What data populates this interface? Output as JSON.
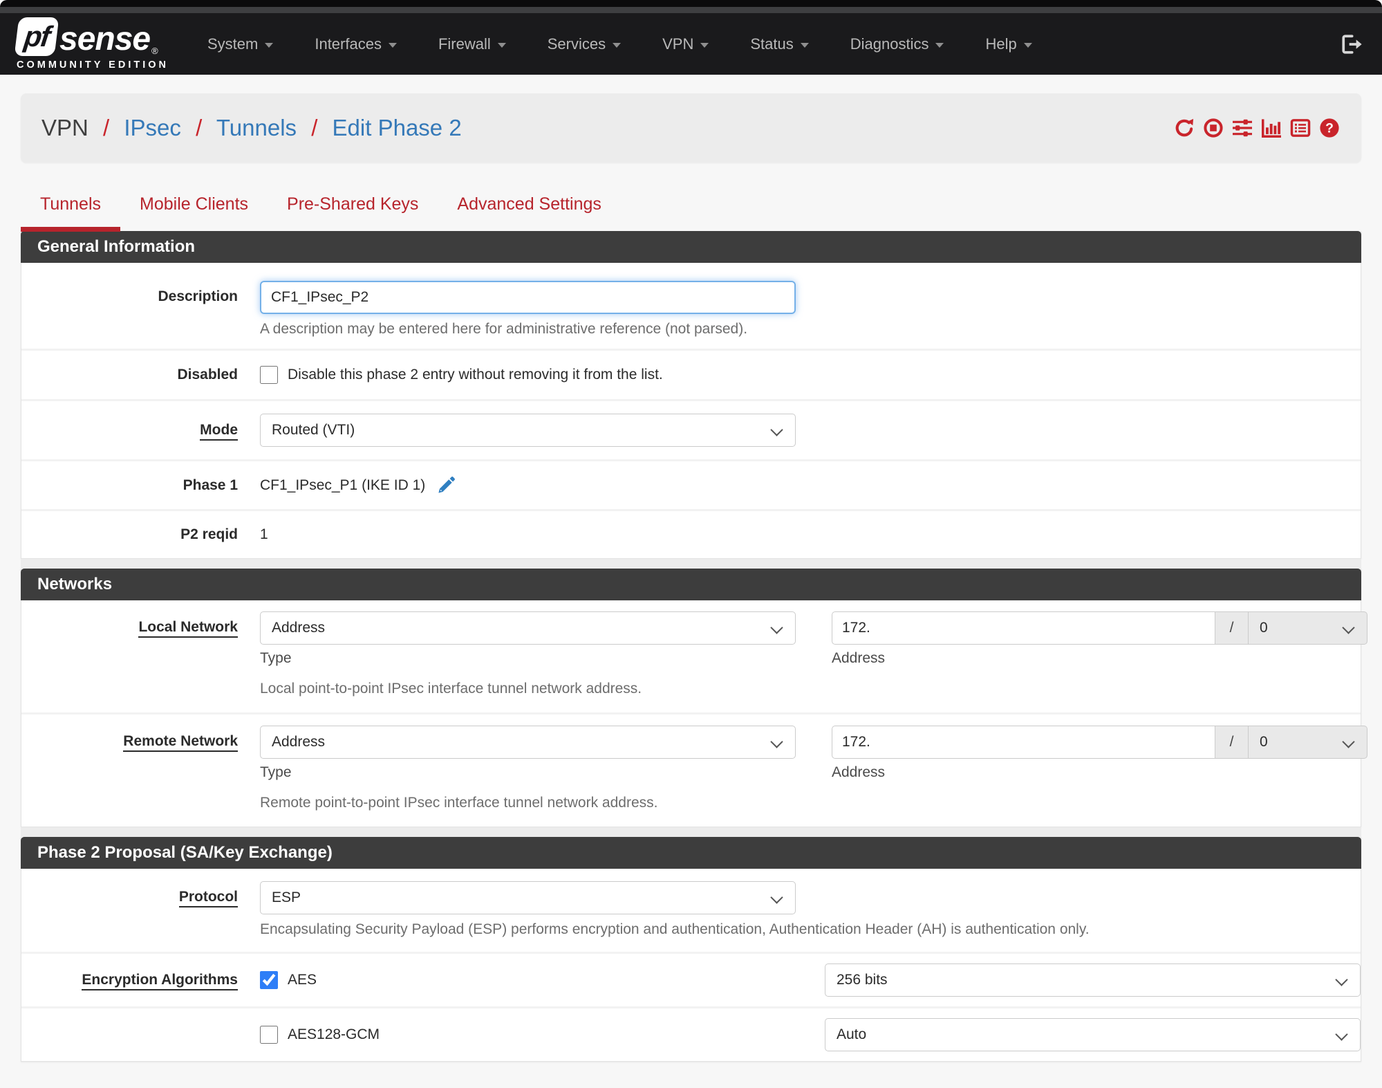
{
  "colors": {
    "accent_red": "#c9242b",
    "link_blue": "#3579b8",
    "checkbox_blue": "#2e7ef7",
    "header_gray": "#3d3d3d"
  },
  "navbar": {
    "brand": {
      "pf": "pf",
      "sense": "sense",
      "mark": "®",
      "edition": "COMMUNITY EDITION"
    },
    "menu": [
      "System",
      "Interfaces",
      "Firewall",
      "Services",
      "VPN",
      "Status",
      "Diagnostics",
      "Help"
    ],
    "logout_icon": "logout-icon"
  },
  "breadcrumb": {
    "root": "VPN",
    "sep": "/",
    "links": [
      "IPsec",
      "Tunnels",
      "Edit Phase 2"
    ],
    "action_icons": [
      "refresh-icon",
      "stop-circle-icon",
      "sliders-icon",
      "chart-bar-icon",
      "log-icon",
      "help-icon"
    ]
  },
  "tabs": [
    "Tunnels",
    "Mobile Clients",
    "Pre-Shared Keys",
    "Advanced Settings"
  ],
  "general": {
    "title": "General Information",
    "description": {
      "label": "Description",
      "value": "CF1_IPsec_P2",
      "help": "A description may be entered here for administrative reference (not parsed)."
    },
    "disabled": {
      "label": "Disabled",
      "checkbox_label": "Disable this phase 2 entry without removing it from the list.",
      "checked": false
    },
    "mode": {
      "label": "Mode",
      "value": "Routed (VTI)"
    },
    "phase1": {
      "label": "Phase 1",
      "value": "CF1_IPsec_P1 (IKE ID 1)",
      "edit_icon": "pencil-icon"
    },
    "p2reqid": {
      "label": "P2 reqid",
      "value": "1"
    }
  },
  "networks": {
    "title": "Networks",
    "local": {
      "label": "Local Network",
      "type_value": "Address",
      "type_caption": "Type",
      "address_value": "172.",
      "address_caption": "Address",
      "mask_sep": "/",
      "mask_value": "0",
      "help": "Local point-to-point IPsec interface tunnel network address."
    },
    "remote": {
      "label": "Remote Network",
      "type_value": "Address",
      "type_caption": "Type",
      "address_value": "172.",
      "address_caption": "Address",
      "mask_sep": "/",
      "mask_value": "0",
      "help": "Remote point-to-point IPsec interface tunnel network address."
    }
  },
  "proposal": {
    "title": "Phase 2 Proposal (SA/Key Exchange)",
    "protocol": {
      "label": "Protocol",
      "value": "ESP",
      "help": "Encapsulating Security Payload (ESP) performs encryption and authentication, Authentication Header (AH) is authentication only."
    },
    "encryption": {
      "label": "Encryption Algorithms",
      "rows": [
        {
          "name": "AES",
          "checked": true,
          "keylen": "256 bits"
        },
        {
          "name": "AES128-GCM",
          "checked": false,
          "keylen": "Auto"
        }
      ]
    }
  }
}
